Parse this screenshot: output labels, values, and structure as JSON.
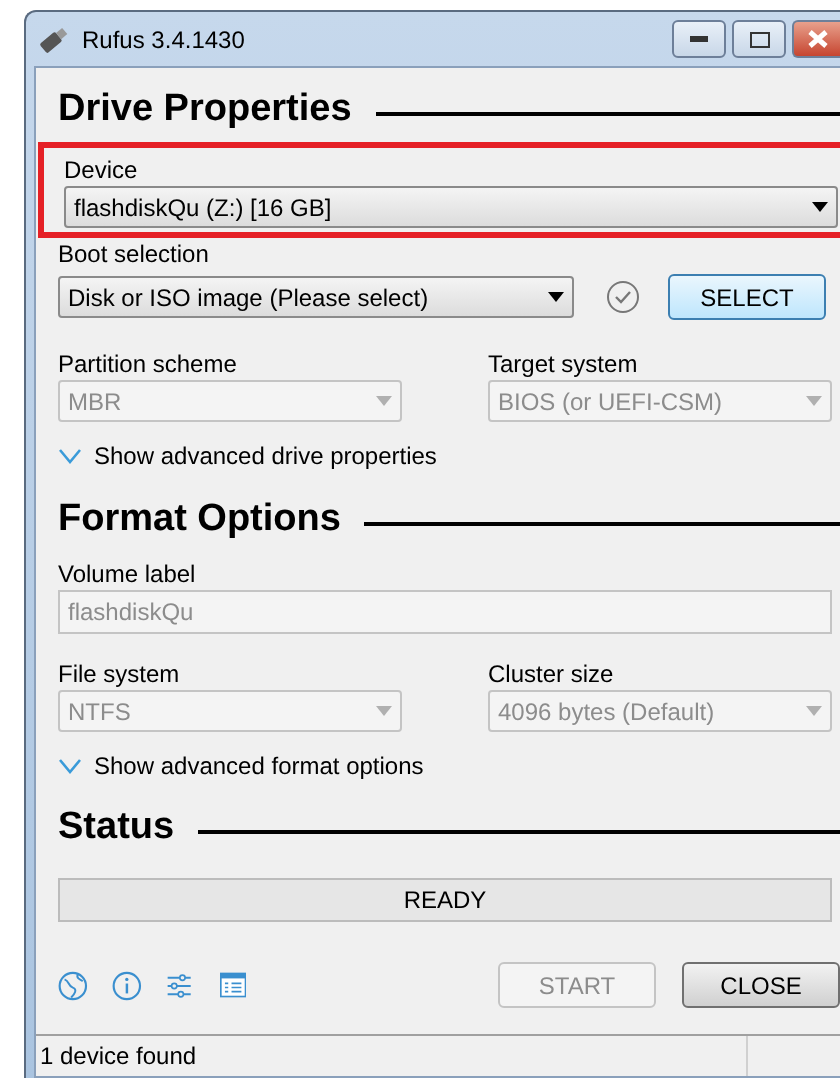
{
  "window": {
    "title": "Rufus 3.4.1430"
  },
  "drive_properties": {
    "heading": "Drive Properties",
    "device": {
      "label": "Device",
      "value": "flashdiskQu (Z:) [16 GB]",
      "highlighted": true
    },
    "boot_selection": {
      "label": "Boot selection",
      "value": "Disk or ISO image (Please select)",
      "button": "SELECT"
    },
    "fields": [
      {
        "label": "Partition scheme",
        "value": "MBR",
        "disabled": true
      },
      {
        "label": "Target system",
        "value": "BIOS (or UEFI-CSM)",
        "disabled": true
      }
    ],
    "advanced_toggle": {
      "label": "Show advanced drive properties",
      "expanded": false
    }
  },
  "format_options": {
    "heading": "Format Options",
    "volume_label": {
      "label": "Volume label",
      "value": "flashdiskQu",
      "disabled": true
    },
    "fields": [
      {
        "label": "File system",
        "value": "NTFS",
        "disabled": true
      },
      {
        "label": "Cluster size",
        "value": "4096 bytes (Default)",
        "disabled": true
      }
    ],
    "advanced_toggle": {
      "label": "Show advanced format options",
      "expanded": false
    }
  },
  "status": {
    "heading": "Status",
    "progress_text": "READY"
  },
  "buttons": [
    {
      "label": "START",
      "disabled": true
    },
    {
      "label": "CLOSE",
      "disabled": false
    }
  ],
  "status_bar": "1 device found"
}
